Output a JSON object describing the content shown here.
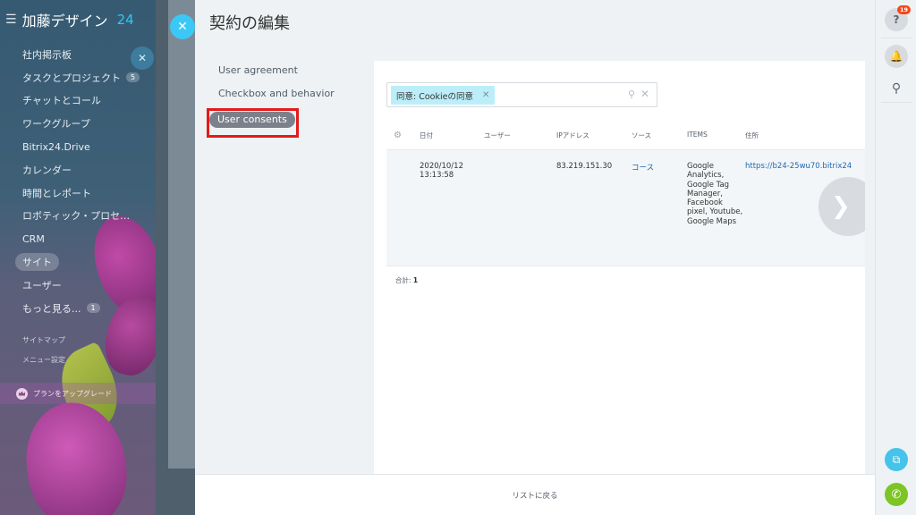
{
  "brand": {
    "name": "加藤デザイン",
    "num": "24"
  },
  "sidebar": {
    "items": [
      {
        "label": "社内掲示板"
      },
      {
        "label": "タスクとプロジェクト",
        "count": "5"
      },
      {
        "label": "チャットとコール"
      },
      {
        "label": "ワークグループ"
      },
      {
        "label": "Bitrix24.Drive"
      },
      {
        "label": "カレンダー"
      },
      {
        "label": "時間とレポート"
      },
      {
        "label": "ロボティック・プロセ…"
      },
      {
        "label": "CRM"
      },
      {
        "label": "サイト"
      },
      {
        "label": "ユーザー"
      },
      {
        "label": "もっと見る...",
        "count": "1"
      }
    ],
    "sitemap": "サイトマップ",
    "menu_settings": "メニュー設定",
    "upgrade": "プランをアップグレード"
  },
  "slider": {
    "title": "契約の編集",
    "menu": [
      {
        "label": "User agreement"
      },
      {
        "label": "Checkbox and behavior"
      },
      {
        "label": "User consents"
      }
    ],
    "filter": {
      "chip": "同意: Cookieの同意"
    },
    "columns": {
      "date": "日付",
      "user": "ユーザー",
      "ip": "IPアドレス",
      "source": "ソース",
      "items": "ITEMS",
      "address": "住所"
    },
    "rows": [
      {
        "date": "2020/10/12 13:13:58",
        "user": "",
        "ip": "83.219.151.30",
        "source": "コース",
        "items": "Google Analytics, Google Tag Manager, Facebook pixel, Youtube, Google Maps",
        "address": "https://b24-25wu70.bitrix24"
      }
    ],
    "total_label": "合計:",
    "total_value": "1",
    "footer": "リストに戻る"
  },
  "right_bar": {
    "help_badge": "19"
  },
  "colors": {
    "accent": "#3bc8f5",
    "highlight": "#e41a1a",
    "link": "#2067b0",
    "chip": "#bceef9",
    "phone": "#7dc425"
  }
}
